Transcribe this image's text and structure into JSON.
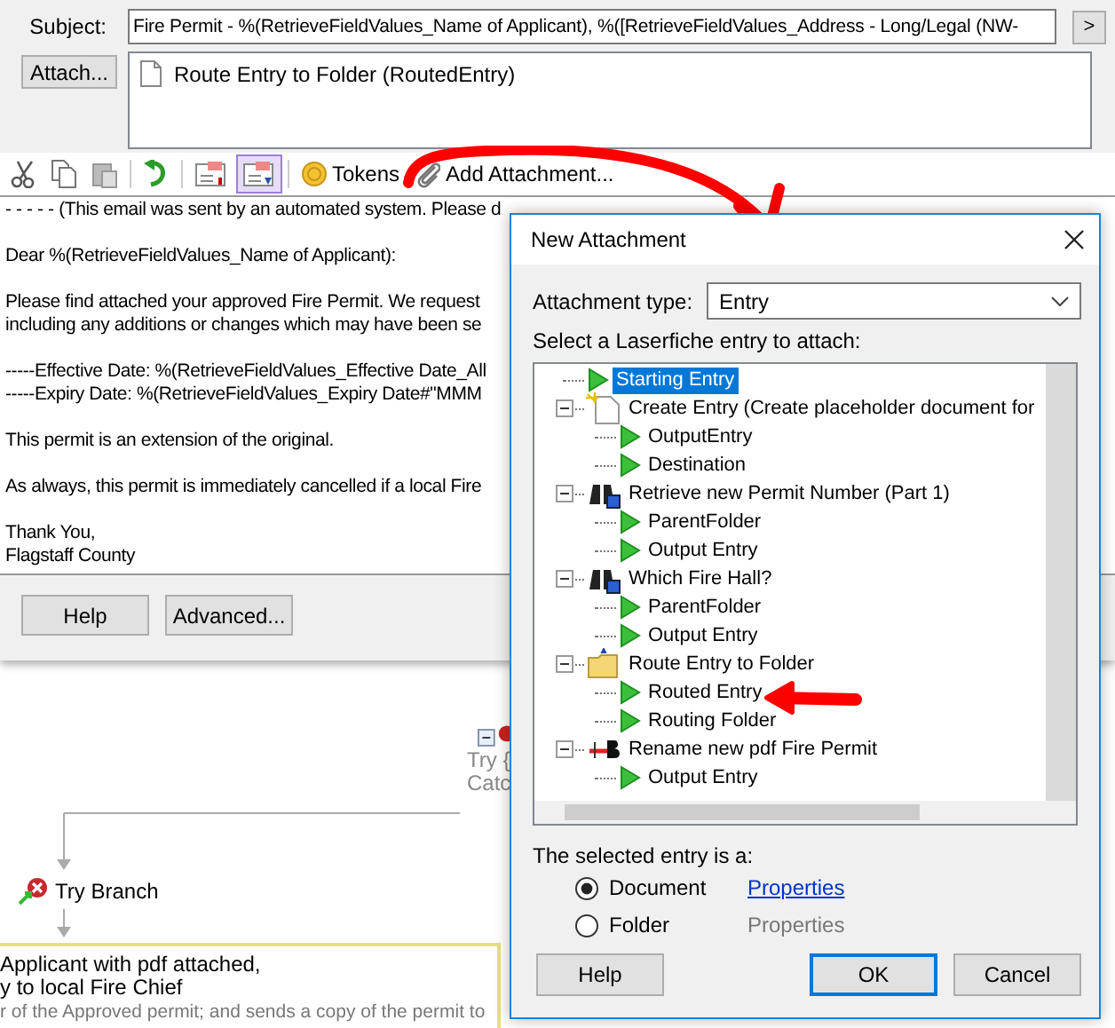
{
  "email": {
    "subject_label": "Subject:",
    "subject": "Fire Permit - %(RetrieveFieldValues_Name of Applicant), %([RetrieveFieldValues_Address - Long/Legal (NW-",
    "more_button": ">",
    "attach_button": "Attach...",
    "attachments": [
      {
        "text": "Route Entry to Folder (RoutedEntry)"
      }
    ],
    "toolbar": [
      {
        "kind": "cut",
        "active": false
      },
      {
        "kind": "copy",
        "active": false
      },
      {
        "kind": "paste",
        "active": false
      },
      {
        "kind": "sep"
      },
      {
        "kind": "undo",
        "active": false
      },
      {
        "kind": "sep"
      },
      {
        "kind": "field",
        "active": false
      },
      {
        "kind": "field2",
        "active": true
      },
      {
        "kind": "sep"
      },
      {
        "kind": "tokens",
        "active": false,
        "label": "Tokens"
      },
      {
        "kind": "attach",
        "active": false,
        "label": "Add Attachment..."
      }
    ],
    "body": [
      [
        "- - - - - (This email was sent by an automated system.  Please d"
      ],
      [
        "Dear %(RetrieveFieldValues_Name of Applicant):"
      ],
      [
        "Please find attached your approved Fire Permit.  We request",
        "including any additions or changes which may have been se"
      ],
      [
        "-----Effective Date: %(RetrieveFieldValues_Effective Date_All",
        "-----Expiry Date:  %(RetrieveFieldValues_Expiry Date#\"MMM"
      ],
      [
        "This permit is an extension of the original."
      ],
      [
        "As always, this permit is immediately cancelled if a local Fire"
      ],
      [
        "Thank You,",
        "Flagstaff County"
      ]
    ],
    "buttons": [
      "Help",
      "Advanced..."
    ]
  },
  "canvas": {
    "try_block": [
      "Try {",
      "Catc"
    ],
    "branch": "Try Branch",
    "activity": [
      {
        "text": "Applicant with pdf attached,",
        "kind": "title"
      },
      {
        "text": "y to local Fire Chief",
        "kind": "title"
      },
      {
        "text": "r of the Approved permit; and sends a copy of the permit to",
        "kind": "desc"
      }
    ]
  },
  "dialog": {
    "title": "New Attachment",
    "type_label": "Attachment type:",
    "type_value": "Entry",
    "tree_label": "Select a Laserfiche entry to attach:",
    "tree": [
      {
        "label": "Starting Entry",
        "kind": "output",
        "selected": true
      },
      {
        "label": "Create Entry (Create placeholder document for",
        "kind": "create",
        "selected": false,
        "expanded": true,
        "children": [
          {
            "label": "OutputEntry",
            "kind": "output",
            "selected": false
          },
          {
            "label": "Destination",
            "kind": "output",
            "selected": false
          }
        ]
      },
      {
        "label": "Retrieve new Permit Number (Part 1)",
        "kind": "search",
        "selected": false,
        "expanded": true,
        "children": [
          {
            "label": "ParentFolder",
            "kind": "output",
            "selected": false
          },
          {
            "label": "Output Entry",
            "kind": "output",
            "selected": false
          }
        ]
      },
      {
        "label": "Which Fire Hall?",
        "kind": "search",
        "selected": false,
        "expanded": true,
        "children": [
          {
            "label": "ParentFolder",
            "kind": "output",
            "selected": false
          },
          {
            "label": "Output Entry",
            "kind": "output",
            "selected": false
          }
        ]
      },
      {
        "label": "Route Entry to Folder",
        "kind": "folder",
        "selected": false,
        "expanded": true,
        "children": [
          {
            "label": "Routed Entry",
            "kind": "output",
            "selected": false
          },
          {
            "label": "Routing Folder",
            "kind": "output",
            "selected": false
          }
        ]
      },
      {
        "label": "Rename new pdf Fire Permit",
        "kind": "rename",
        "selected": false,
        "expanded": true,
        "children": [
          {
            "label": "Output Entry",
            "kind": "output",
            "selected": false
          }
        ]
      }
    ],
    "selected_label": "The selected entry is a:",
    "options": [
      {
        "label": "Document",
        "selected": true,
        "link": "Properties",
        "link_enabled": true
      },
      {
        "label": "Folder",
        "selected": false,
        "link": "Properties",
        "link_enabled": false
      }
    ],
    "buttons": [
      {
        "label": "Help",
        "default": false
      },
      {
        "label": "OK",
        "default": true
      },
      {
        "label": "Cancel",
        "default": false
      }
    ]
  }
}
